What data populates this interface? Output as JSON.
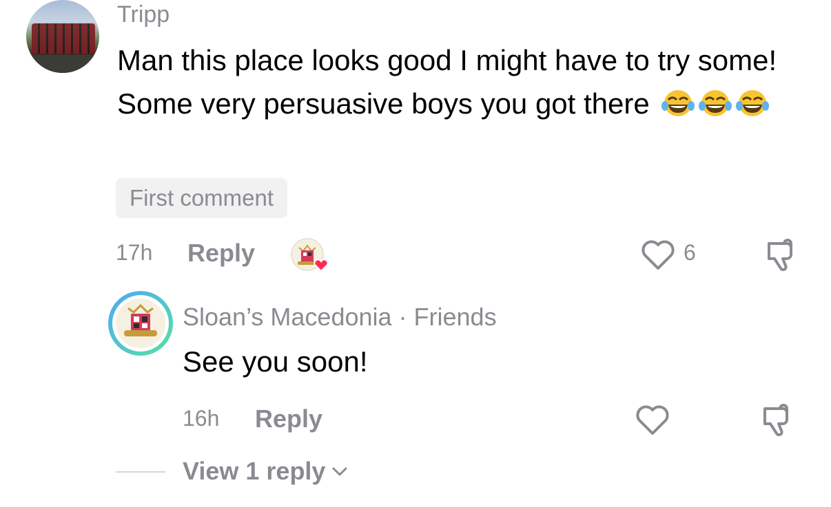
{
  "comment": {
    "username": "Tripp",
    "text": "Man this place looks good I might have to try some! Some very persuasive boys you got there",
    "emoji_icons": [
      "face-with-tears-of-joy-icon",
      "face-with-tears-of-joy-icon",
      "face-with-tears-of-joy-icon"
    ],
    "badge": "First comment",
    "time": "17h",
    "reply_label": "Reply",
    "like_count": "6"
  },
  "reply": {
    "username": "Sloan’s Macedonia · Friends",
    "text": "See you soon!",
    "time": "16h",
    "reply_label": "Reply"
  },
  "view_replies_label": "View 1 reply",
  "colors": {
    "muted": "#8a8b91",
    "text": "#000000",
    "badge_bg": "#f1f1f2",
    "heart_red": "#fe2c55",
    "ring_blue": "#4fa9f5",
    "ring_green": "#55e0a5"
  }
}
